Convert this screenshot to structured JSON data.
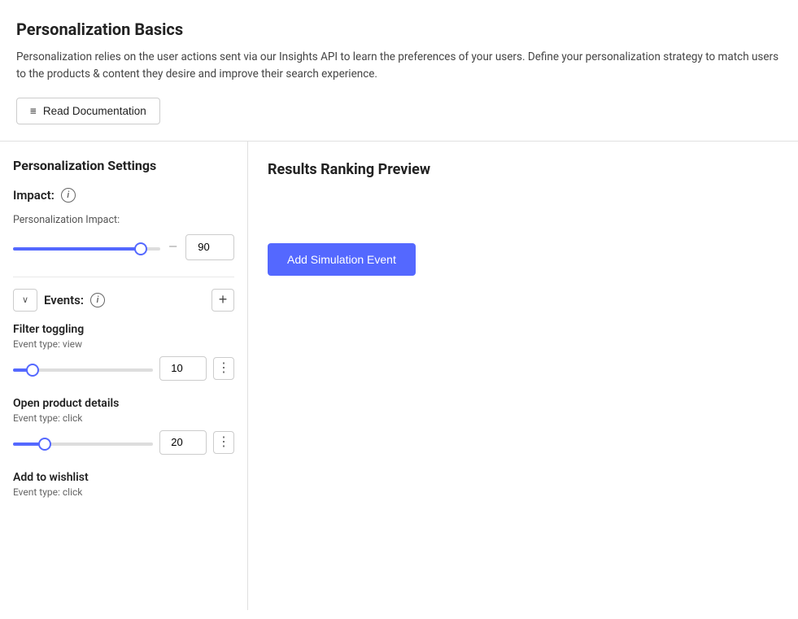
{
  "top": {
    "title": "Personalization Basics",
    "description": "Personalization relies on the user actions sent via our Insights API to learn the preferences of your users. Define your personalization strategy to match users to the products & content they desire and improve their search experience.",
    "read_docs_btn": "Read Documentation"
  },
  "left": {
    "section_title": "Personalization Settings",
    "impact": {
      "label": "Impact:",
      "personalization_label": "Personalization Impact:",
      "value": "90"
    },
    "events": {
      "label": "Events:",
      "items": [
        {
          "name": "Filter toggling",
          "event_type": "Event type: view",
          "value": "10"
        },
        {
          "name": "Open product details",
          "event_type": "Event type: click",
          "value": "20"
        },
        {
          "name": "Add to wishlist",
          "event_type": "Event type: click",
          "value": ""
        }
      ]
    }
  },
  "right": {
    "title": "Results Ranking Preview",
    "add_sim_btn": "Add Simulation Event"
  },
  "icons": {
    "menu": "≡",
    "info": "i",
    "chevron_down": "∨",
    "plus": "+",
    "kebab": "⋮"
  }
}
